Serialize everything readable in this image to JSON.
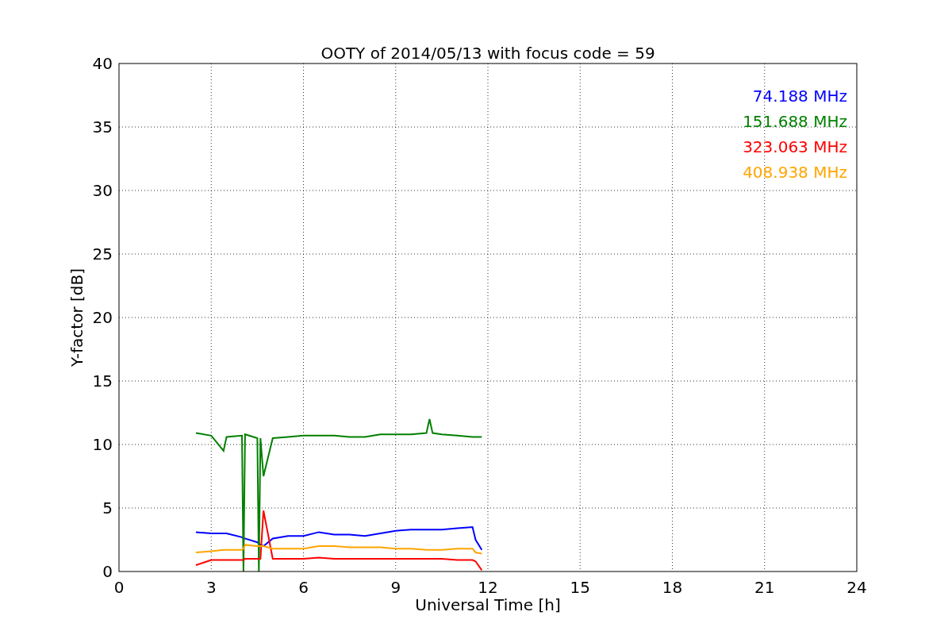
{
  "figure": {
    "chart_data": {
      "type": "line",
      "title": "OOTY of 2014/05/13 with focus code = 59",
      "xlabel": "Universal Time [h]",
      "ylabel": "Y-factor [dB]",
      "x": [
        2.5,
        3,
        3.4,
        3.5,
        4,
        4.05,
        4.1,
        4.5,
        4.55,
        4.6,
        4.7,
        5,
        5.5,
        6,
        6.5,
        7,
        7.5,
        8,
        8.5,
        9,
        9.5,
        10,
        10.1,
        10.2,
        10.5,
        11,
        11.5,
        11.6,
        11.8
      ],
      "series": [
        {
          "name": "74.188 MHz",
          "color": "#0000ff",
          "values": [
            3.1,
            3.0,
            3.0,
            3.0,
            2.7,
            2.6,
            2.6,
            2.3,
            2.2,
            2.1,
            2.0,
            2.6,
            2.8,
            2.8,
            3.1,
            2.9,
            2.9,
            2.8,
            3.0,
            3.2,
            3.3,
            3.3,
            3.3,
            3.3,
            3.3,
            3.4,
            3.5,
            2.5,
            1.7
          ]
        },
        {
          "name": "151.688 MHz",
          "color": "#008000",
          "values": [
            10.9,
            10.7,
            9.5,
            10.6,
            10.7,
            0,
            10.8,
            10.5,
            0,
            10.5,
            7.5,
            10.5,
            10.6,
            10.7,
            10.7,
            10.7,
            10.6,
            10.6,
            10.8,
            10.8,
            10.8,
            10.9,
            12.0,
            10.9,
            10.8,
            10.7,
            10.6,
            10.6,
            10.6
          ]
        },
        {
          "name": "323.063 MHz",
          "color": "#ff0000",
          "values": [
            0.5,
            0.9,
            0.9,
            0.9,
            0.9,
            0.9,
            1.0,
            1.0,
            1.0,
            1.0,
            4.8,
            1.0,
            1.0,
            1.0,
            1.1,
            1.0,
            1.0,
            1.0,
            1.0,
            1.0,
            1.0,
            1.0,
            1.0,
            1.0,
            1.0,
            0.9,
            0.9,
            0.8,
            0.1
          ]
        },
        {
          "name": "408.938 MHz",
          "color": "#ffa500",
          "values": [
            1.5,
            1.6,
            1.7,
            1.7,
            1.7,
            1.8,
            2.1,
            2.0,
            2.0,
            2.0,
            2.0,
            1.8,
            1.8,
            1.8,
            2.0,
            2.0,
            1.9,
            1.9,
            1.9,
            1.8,
            1.8,
            1.7,
            1.7,
            1.7,
            1.7,
            1.8,
            1.8,
            1.5,
            1.4
          ]
        }
      ],
      "grid": true,
      "xlim": [
        0,
        24
      ],
      "ylim": [
        0,
        40
      ],
      "xticks": [
        0,
        3,
        6,
        9,
        12,
        15,
        18,
        21,
        24
      ],
      "yticks": [
        0,
        5,
        10,
        15,
        20,
        25,
        30,
        35,
        40
      ]
    }
  }
}
